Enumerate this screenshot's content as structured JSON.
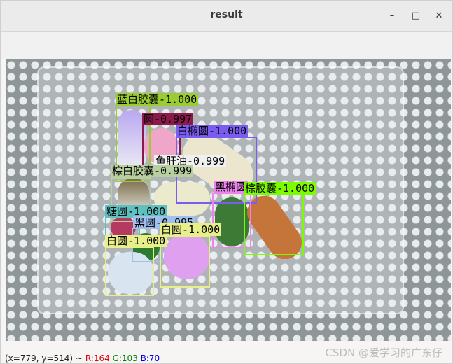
{
  "window": {
    "title": "result"
  },
  "controls": {
    "minimize": "–",
    "maximize": "□",
    "close": "✕"
  },
  "detections": [
    {
      "label": "蓝白胶囊-1.000",
      "color": "#9acd32"
    },
    {
      "label": "圆-0.997",
      "color": "#8b1a4a"
    },
    {
      "label": "白椭圆-1.000",
      "color": "#7b5cf0"
    },
    {
      "label": "鱼肝油-0.999",
      "color": "#f0f0f0"
    },
    {
      "label": "棕白胶囊-0.999",
      "color": "#b8d0a0"
    },
    {
      "label": "黑椭圆",
      "color": "#ee82ee"
    },
    {
      "label": "棕胶囊-1.000",
      "color": "#7cfc00"
    },
    {
      "label": "糖圆-1.000",
      "color": "#5fc0c0"
    },
    {
      "label": "黑圆-0.995",
      "color": "#a0c0f0"
    },
    {
      "label": "白圆-1.000",
      "color": "#e8ee8a"
    },
    {
      "label": "白圆-1.000",
      "color": "#e8ee8a"
    }
  ],
  "status": {
    "coords": "(x=779, y=514) ~",
    "r": "R:164",
    "g": "G:103",
    "b": "B:70",
    "watermark": "CSDN @爱学习的广东仔"
  }
}
